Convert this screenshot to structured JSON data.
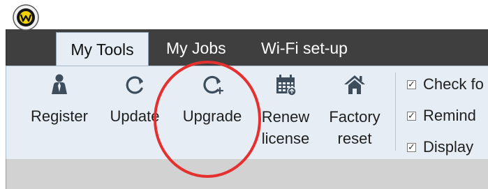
{
  "app": {
    "logo_icon": "app-logo-icon"
  },
  "tabs": [
    {
      "label": "My Tools",
      "active": true
    },
    {
      "label": "My Jobs",
      "active": false
    },
    {
      "label": "Wi-Fi set-up",
      "active": false
    }
  ],
  "ribbon": {
    "buttons": [
      {
        "label": "Register",
        "icon": "person-icon"
      },
      {
        "label": "Update",
        "icon": "refresh-icon"
      },
      {
        "label": "Upgrade",
        "icon": "refresh-plus-icon"
      },
      {
        "label": "Renew\nlicense",
        "icon": "calendar-icon"
      },
      {
        "label": "Factory\nreset",
        "icon": "home-icon"
      }
    ],
    "options": [
      {
        "label": "Check fo",
        "checked": true
      },
      {
        "label": "Remind",
        "checked": true
      },
      {
        "label": "Display",
        "checked": true
      }
    ]
  },
  "annotation": {
    "color": "#e53030",
    "target": "Upgrade"
  },
  "colors": {
    "titlebar": "#3f3f3f",
    "ribbon": "#e6edf5",
    "bottom_bar": "#d2d2d2",
    "icon": "#3d4d5c"
  }
}
